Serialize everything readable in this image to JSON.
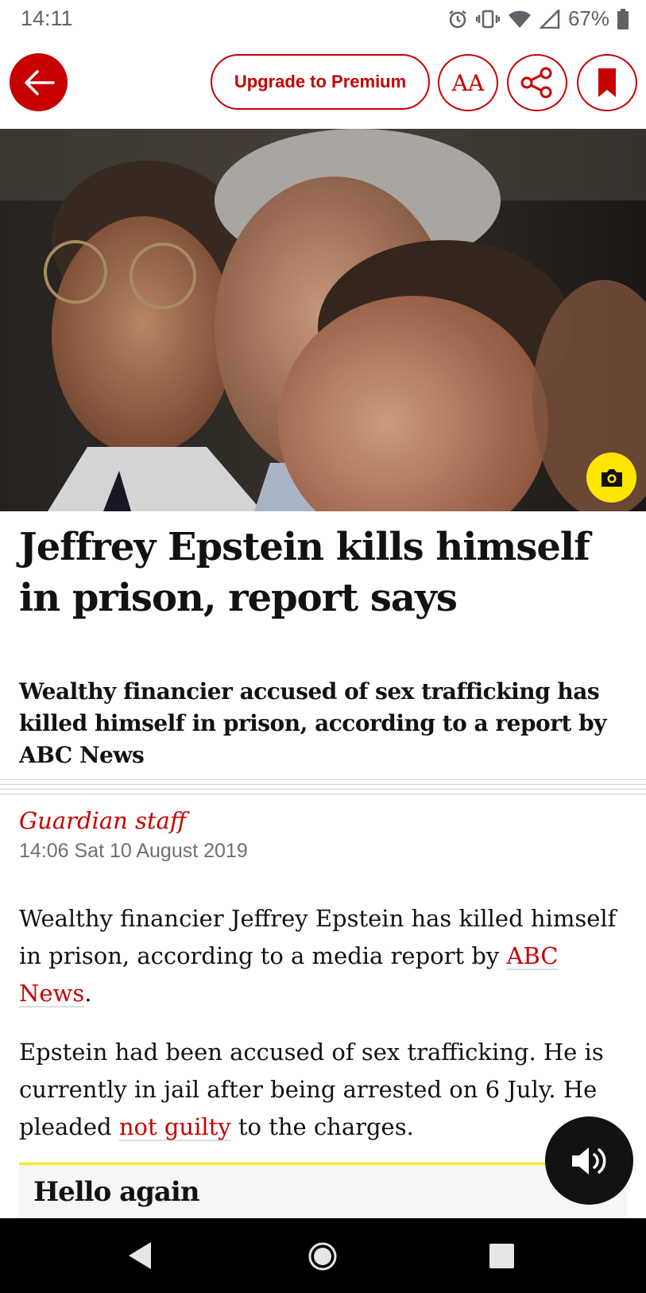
{
  "status_bar": {
    "time": "14:11",
    "battery": "67%",
    "icons": [
      "alarm-icon",
      "vibrate-icon",
      "wifi-icon",
      "signal-icon",
      "battery-icon"
    ]
  },
  "toolbar": {
    "back_icon": "arrow-left-icon",
    "premium_label": "Upgrade to Premium",
    "font_size_label": "AA",
    "share_icon": "share-icon",
    "bookmark_icon": "bookmark-icon"
  },
  "article": {
    "headline": "Jeffrey Epstein kills himself in prison, report says",
    "standfirst": "Wealthy financier accused of sex trafficking has killed himself in prison, according to a report by ABC News",
    "byline": "Guardian staff",
    "dateline": "14:06 Sat 10 August 2019",
    "p1_before": "Wealthy financier Jeffrey Epstein has killed himself in prison, according to a media report by ",
    "p1_link": "ABC News",
    "p1_after": ".",
    "p2_before": "Epstein had been accused of sex trafficking. He is currently in jail after being arrested on 6 July. He pleaded ",
    "p2_link": "not guilty",
    "p2_after": " to the charges."
  },
  "epic": {
    "title": "Hello again"
  },
  "colors": {
    "accent": "#c70000",
    "camera": "#ffe500",
    "text": "#121212"
  }
}
